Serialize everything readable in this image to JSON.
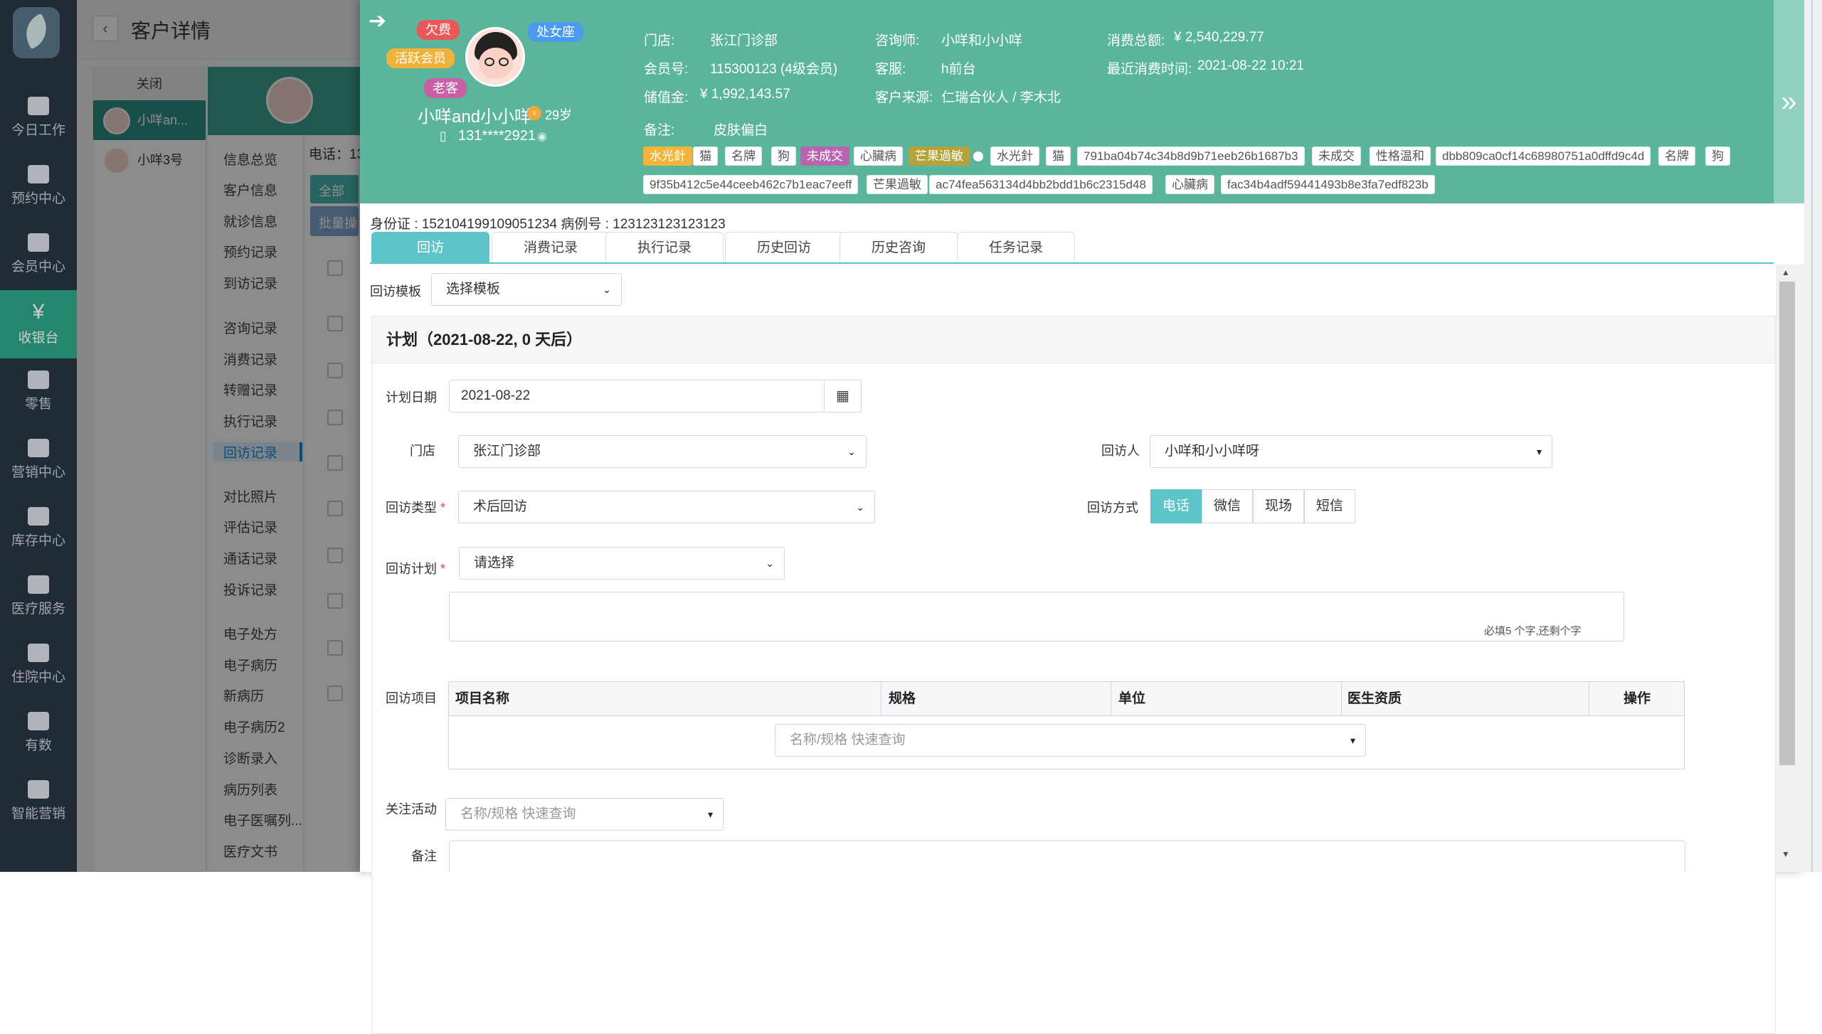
{
  "nav": [
    {
      "label": "今日工作",
      "icon": "monitor-icon"
    },
    {
      "label": "预约中心",
      "icon": "calendar-icon"
    },
    {
      "label": "会员中心",
      "icon": "members-icon"
    },
    {
      "label": "收银台",
      "icon": "yen-icon"
    },
    {
      "label": "零售",
      "icon": "cart-icon"
    },
    {
      "label": "营销中心",
      "icon": "megaphone-icon"
    },
    {
      "label": "库存中心",
      "icon": "grid-icon"
    },
    {
      "label": "医疗服务",
      "icon": "medkit-icon"
    },
    {
      "label": "住院中心",
      "icon": "building-icon"
    },
    {
      "label": "有数",
      "icon": "chart-icon"
    },
    {
      "label": "智能营销",
      "icon": "ai-icon"
    }
  ],
  "nav_active_glyph": "¥",
  "page_title": "客户详情",
  "back_glyph": "‹",
  "bg": {
    "close_label": "关闭",
    "customers": [
      "小咩an...",
      "小咩3号"
    ],
    "menu": [
      "信息总览",
      "客户信息",
      "就诊信息",
      "预约记录",
      "到访记录",
      "咨询记录",
      "消费记录",
      "转赠记录",
      "执行记录",
      "回访记录",
      "对比照片",
      "评估记录",
      "通话记录",
      "投诉记录",
      "电子处方",
      "电子病历",
      "新病历",
      "电子病历2",
      "诊断录入",
      "病历列表",
      "电子医嘱列...",
      "医疗文书"
    ],
    "phone_label": "电话：13",
    "all_btn": "全部",
    "batch_btn": "批量操"
  },
  "header": {
    "bubbles": [
      "欠费",
      "处女座",
      "活跃会员",
      "老客"
    ],
    "name": "小咩and小小咩",
    "age": "29岁",
    "phone": "131****2921",
    "store_label": "门店:",
    "store": "张江门诊部",
    "consultant_label": "咨询师:",
    "consultant": "小咩和小小咩",
    "total_label": "消费总额:",
    "total": "¥ 2,540,229.77",
    "member_label": "会员号:",
    "member": "115300123 (4级会员)",
    "service_label": "客服:",
    "service": "h前台",
    "last_label": "最近消费时间:",
    "last": "2021-08-22 10:21",
    "balance_label": "储值金:",
    "balance": "¥ 1,992,143.57",
    "source_label": "客户来源:",
    "source": "仁瑞合伙人 / 李木北",
    "note_label": "备注:",
    "note": "皮肤偏白",
    "tags_row1": [
      "水光針",
      "猫",
      "名牌",
      "狗",
      "未成交",
      "心臟病",
      "芒果過敏",
      "水光針",
      "猫",
      "791ba04b74c34b8d9b71eeb26b1687b3",
      "未成交",
      "性格温和",
      "dbb809ca0cf14c68980751a0dffd9c4d",
      "名牌",
      "狗"
    ],
    "tags_row2": [
      "9f35b412c5e44ceeb462c7b1eac7eeff",
      "芒果過敏",
      "ac74fea563134d4bb2bdd1b6c2315d48",
      "心臟病",
      "fac34b4adf59441493b8e3fa7edf823b"
    ],
    "collapse_glyph": "»"
  },
  "id_line": "身份证 : 152104199109051234  病例号 : 123123123123123",
  "tabs": [
    "回访",
    "消费记录",
    "执行记录",
    "历史回访",
    "历史咨询",
    "任务记录"
  ],
  "form": {
    "template_label": "回访模板",
    "template_value": "选择模板",
    "plan_title": "计划（2021-08-22, 0 天后）",
    "date_label": "计划日期",
    "date_value": "2021-08-22",
    "store_label": "门店",
    "store_value": "张江门诊部",
    "visitor_label": "回访人",
    "visitor_value": "小咩和小小咩呀",
    "type_label": "回访类型",
    "type_value": "术后回访",
    "method_label": "回访方式",
    "methods": [
      "电话",
      "微信",
      "现场",
      "短信"
    ],
    "plan_label": "回访计划",
    "plan_value": "请选择",
    "hint": "必填5 个字,还剩个字",
    "items_label": "回访项目",
    "columns": [
      "项目名称",
      "规格",
      "单位",
      "医生资质",
      "操作"
    ],
    "search_placeholder": "名称/规格 快速查询",
    "activity_label": "关注活动",
    "activity_placeholder": "名称/规格 快速查询",
    "remark_label": "备注",
    "required_mark": "*"
  }
}
